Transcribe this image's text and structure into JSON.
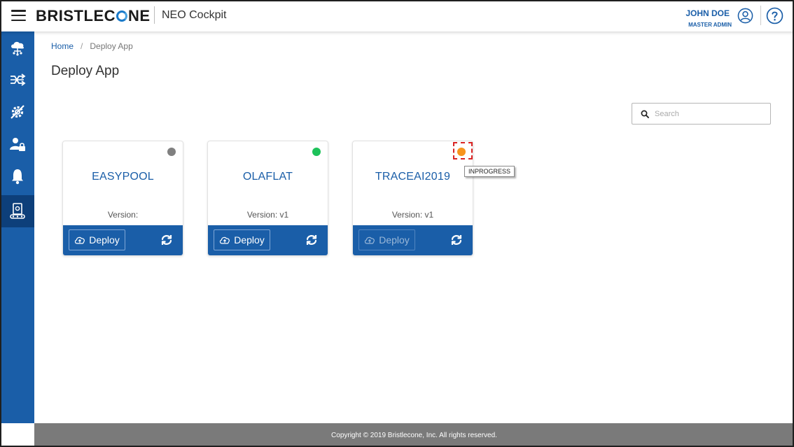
{
  "header": {
    "brand_prefix": "BRISTLEC",
    "brand_suffix": "NE",
    "app_title": "NEO Cockpit",
    "user_name": "JOHN DOE",
    "user_role": "MASTER ADMIN"
  },
  "sidebar": {
    "items": [
      {
        "icon": "cloud-network-icon"
      },
      {
        "icon": "shuffle-icon"
      },
      {
        "icon": "settings-off-icon"
      },
      {
        "icon": "user-lock-icon"
      },
      {
        "icon": "bell-icon"
      },
      {
        "icon": "deploy-app-icon",
        "active": true
      }
    ]
  },
  "breadcrumb": {
    "home": "Home",
    "separator": "/",
    "current": "Deploy App"
  },
  "page": {
    "title": "Deploy App"
  },
  "search": {
    "placeholder": "Search"
  },
  "cards": [
    {
      "name": "EASYPOOL",
      "version": "Version:",
      "status_color": "#808080",
      "deploy_label": "Deploy",
      "deploy_enabled": true
    },
    {
      "name": "OLAFLAT",
      "version": "Version: v1",
      "status_color": "#1ec25a",
      "deploy_label": "Deploy",
      "deploy_enabled": true
    },
    {
      "name": "TRACEAI2019",
      "version": "Version: v1",
      "status_color": "#f7941d",
      "deploy_label": "Deploy",
      "deploy_enabled": false
    }
  ],
  "tooltip": {
    "text": "INPROGRESS"
  },
  "footer": {
    "copyright": "Copyright © 2019 Bristlecone, Inc. All rights reserved."
  },
  "colors": {
    "primary": "#1a5ea8",
    "sidebar_active": "#0d3f7a",
    "footer": "#7a7a7a"
  }
}
